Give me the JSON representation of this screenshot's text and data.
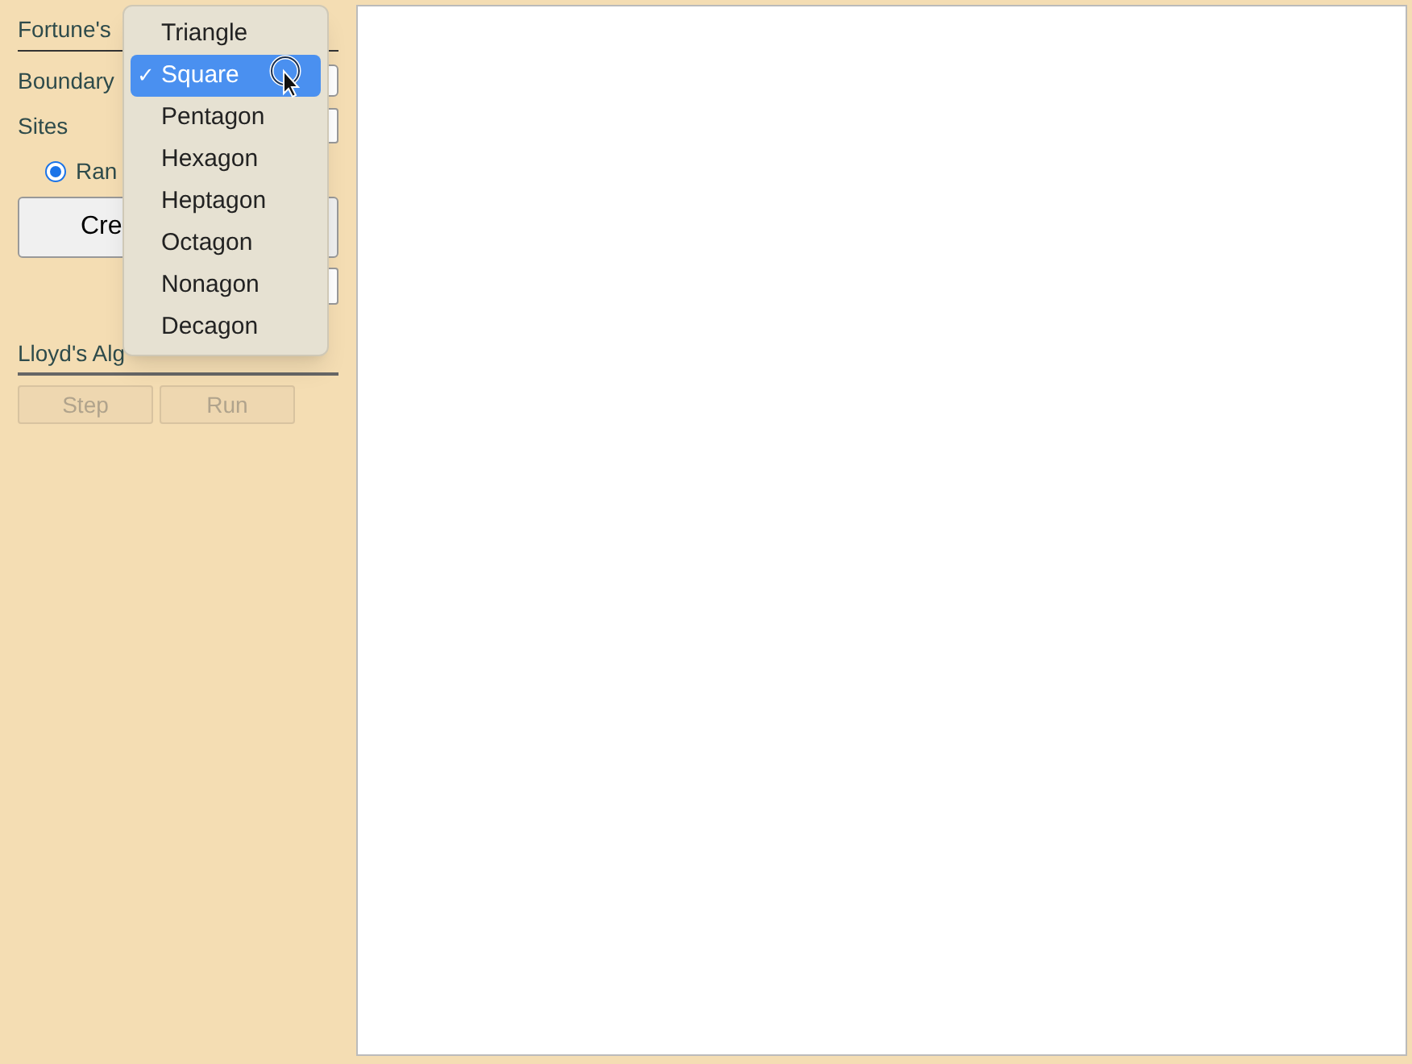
{
  "sidebar": {
    "section_1": {
      "title": "Fortune's"
    },
    "boundary": {
      "label": "Boundary"
    },
    "sites": {
      "label": "Sites"
    },
    "radio": {
      "label": "Ran",
      "selected": true
    },
    "create_button": {
      "label": "Cre"
    },
    "section_2": {
      "title": "Lloyd's Alg"
    },
    "buttons": [
      {
        "label": "Step",
        "disabled": true
      },
      {
        "label": "Run",
        "disabled": true
      }
    ]
  },
  "dropdown": {
    "options": [
      {
        "label": "Triangle",
        "selected": false
      },
      {
        "label": "Square",
        "selected": true
      },
      {
        "label": "Pentagon",
        "selected": false
      },
      {
        "label": "Hexagon",
        "selected": false
      },
      {
        "label": "Heptagon",
        "selected": false
      },
      {
        "label": "Octagon",
        "selected": false
      },
      {
        "label": "Nonagon",
        "selected": false
      },
      {
        "label": "Decagon",
        "selected": false
      }
    ],
    "check_mark": "✓"
  }
}
